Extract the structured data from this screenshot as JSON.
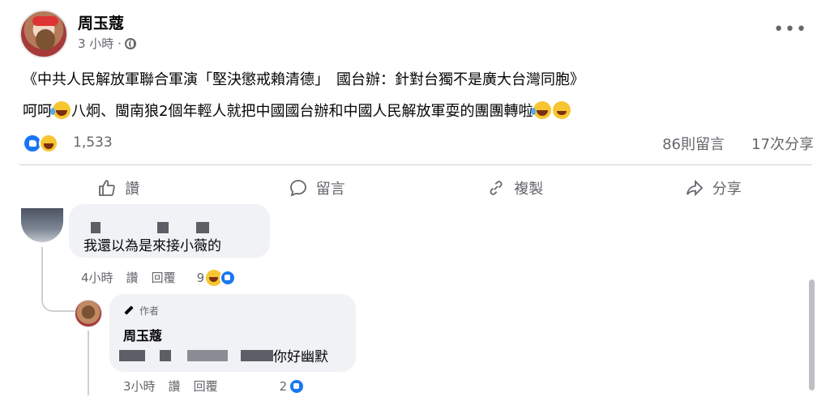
{
  "post": {
    "author": "周玉蔻",
    "time": "3 小時 ·",
    "title": "《中共人民解放軍聯合軍演「堅決懲戒賴清德」　國台辦：針對台獨不是廣大台灣同胞》",
    "body_part1": "呵呵",
    "body_part2": "八炯、閩南狼2個年輕人就把中國國台辦和中國人民解放軍耍的團團轉啦",
    "reaction_count": "1,533",
    "comment_count": "86則留言",
    "share_count": "17次分享"
  },
  "actions": {
    "like": "讚",
    "comment": "留言",
    "copy": "複製",
    "share": "分享"
  },
  "comments": [
    {
      "text": "我還以為是來接小薇的",
      "time": "4小時",
      "like_label": "讚",
      "reply_label": "回覆",
      "reaction_count": "9"
    }
  ],
  "reply": {
    "badge": "作者",
    "author": "周玉蔻",
    "text": "你好幽默",
    "time": "3小時",
    "like_label": "讚",
    "reply_label": "回覆",
    "reaction_count": "2"
  },
  "icons": {
    "privacy": "globe-icon",
    "more": "more-horizontal-icon",
    "like": "thumbs-up-icon",
    "comment": "comment-bubble-icon",
    "copy": "link-icon",
    "share": "share-arrow-icon",
    "author_badge": "pen-icon"
  },
  "colors": {
    "facebook_blue": "#1877f2",
    "secondary_text": "#65676b",
    "comment_bg": "#f0f2f5"
  }
}
